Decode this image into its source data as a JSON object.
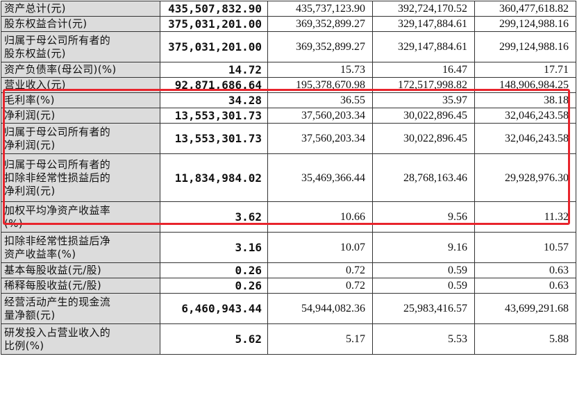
{
  "colors": {
    "label_bg": "#dcdcdc",
    "highlight_border": "#e8242c",
    "grid": "#333333"
  },
  "rows": [
    {
      "label": [
        "资产总计(元)"
      ],
      "cur": "435,507,832.90",
      "v1": "435,737,123.90",
      "v2": "392,724,170.52",
      "v3": "360,477,618.82"
    },
    {
      "label": [
        "股东权益合计(元)"
      ],
      "cur": "375,031,201.00",
      "v1": "369,352,899.27",
      "v2": "329,147,884.61",
      "v3": "299,124,988.16"
    },
    {
      "label": [
        "归属于母公司所有者的",
        "股东权益(元)"
      ],
      "cur": "375,031,201.00",
      "v1": "369,352,899.27",
      "v2": "329,147,884.61",
      "v3": "299,124,988.16"
    },
    {
      "label": [
        "资产负债率(母公司)(%)"
      ],
      "cur": "14.72",
      "v1": "15.73",
      "v2": "16.47",
      "v3": "17.71"
    },
    {
      "label": [
        "营业收入(元)"
      ],
      "cur": "92,871,686.64",
      "v1": "195,378,670.98",
      "v2": "172,517,998.82",
      "v3": "148,906,984.25"
    },
    {
      "label": [
        "毛利率(%)"
      ],
      "cur": "34.28",
      "v1": "36.55",
      "v2": "35.97",
      "v3": "38.18"
    },
    {
      "label": [
        "净利润(元)"
      ],
      "cur": "13,553,301.73",
      "v1": "37,560,203.34",
      "v2": "30,022,896.45",
      "v3": "32,046,243.58"
    },
    {
      "label": [
        "归属于母公司所有者的",
        "净利润(元)"
      ],
      "cur": "13,553,301.73",
      "v1": "37,560,203.34",
      "v2": "30,022,896.45",
      "v3": "32,046,243.58"
    },
    {
      "label": [
        "归属于母公司所有者的",
        "扣除非经常性损益后的",
        "净利润(元)"
      ],
      "cur": "11,834,984.02",
      "v1": "35,469,366.44",
      "v2": "28,768,163.46",
      "v3": "29,928,976.30"
    },
    {
      "label": [
        "加权平均净资产收益率",
        "(%)"
      ],
      "cur": "3.62",
      "v1": "10.66",
      "v2": "9.56",
      "v3": "11.32"
    },
    {
      "label": [
        "扣除非经常性损益后净",
        "资产收益率(%)"
      ],
      "cur": "3.16",
      "v1": "10.07",
      "v2": "9.16",
      "v3": "10.57"
    },
    {
      "label": [
        "基本每股收益(元/股)"
      ],
      "cur": "0.26",
      "v1": "0.72",
      "v2": "0.59",
      "v3": "0.63"
    },
    {
      "label": [
        "稀释每股收益(元/股)"
      ],
      "cur": "0.26",
      "v1": "0.72",
      "v2": "0.59",
      "v3": "0.63"
    },
    {
      "label": [
        "经营活动产生的现金流",
        "量净额(元)"
      ],
      "cur": "6,460,943.44",
      "v1": "54,944,082.36",
      "v2": "25,983,416.57",
      "v3": "43,699,291.68"
    },
    {
      "label": [
        "研发投入占营业收入的",
        "比例(%)"
      ],
      "cur": "5.62",
      "v1": "5.17",
      "v2": "5.53",
      "v3": "5.88"
    }
  ]
}
